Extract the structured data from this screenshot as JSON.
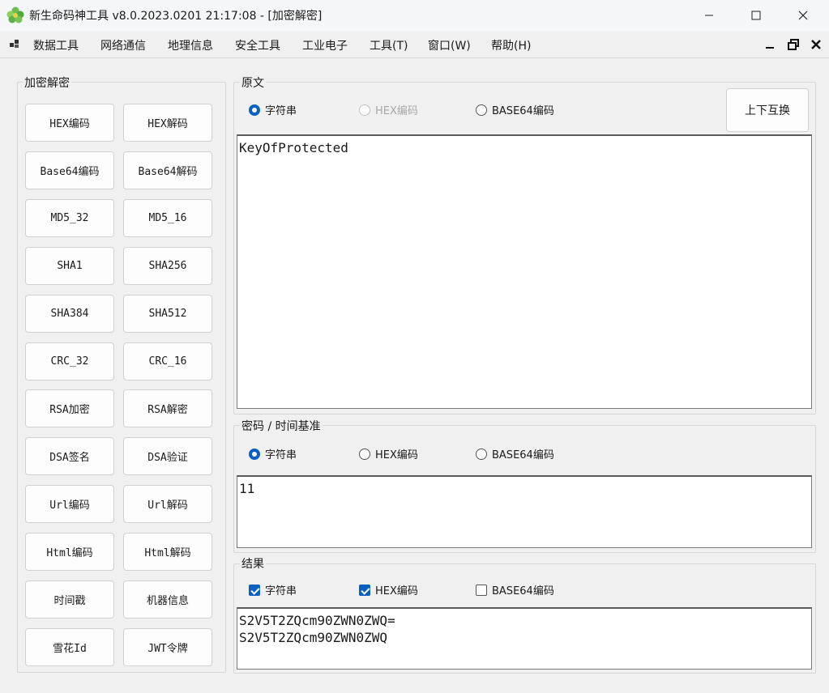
{
  "window": {
    "title": "新生命码神工具 v8.0.2023.0201 21:17:08 - [加密解密]"
  },
  "menu": {
    "items": [
      "数据工具",
      "网络通信",
      "地理信息",
      "安全工具",
      "工业电子",
      "工具(T)",
      "窗口(W)",
      "帮助(H)"
    ]
  },
  "left_panel": {
    "title": "加密解密",
    "buttons": [
      [
        "HEX编码",
        "HEX解码"
      ],
      [
        "Base64编码",
        "Base64解码"
      ],
      [
        "MD5_32",
        "MD5_16"
      ],
      [
        "SHA1",
        "SHA256"
      ],
      [
        "SHA384",
        "SHA512"
      ],
      [
        "CRC_32",
        "CRC_16"
      ],
      [
        "RSA加密",
        "RSA解密"
      ],
      [
        "DSA签名",
        "DSA验证"
      ],
      [
        "Url编码",
        "Url解码"
      ],
      [
        "Html编码",
        "Html解码"
      ],
      [
        "时间戳",
        "机器信息"
      ],
      [
        "雪花Id",
        "JWT令牌"
      ]
    ]
  },
  "source": {
    "title": "原文",
    "options": [
      "字符串",
      "HEX编码",
      "BASE64编码"
    ],
    "swap_label": "上下互换",
    "text": "KeyOfProtected"
  },
  "password": {
    "title": "密码 / 时间基准",
    "options": [
      "字符串",
      "HEX编码",
      "BASE64编码"
    ],
    "text": "11"
  },
  "result": {
    "title": "结果",
    "options": [
      "字符串",
      "HEX编码",
      "BASE64编码"
    ],
    "lines": [
      "S2V5T2ZQcm90ZWN0ZWQ=",
      "S2V5T2ZQcm90ZWN0ZWQ"
    ]
  },
  "colors": {
    "accent": "#0a60c0",
    "logo": "#5bb14a"
  }
}
